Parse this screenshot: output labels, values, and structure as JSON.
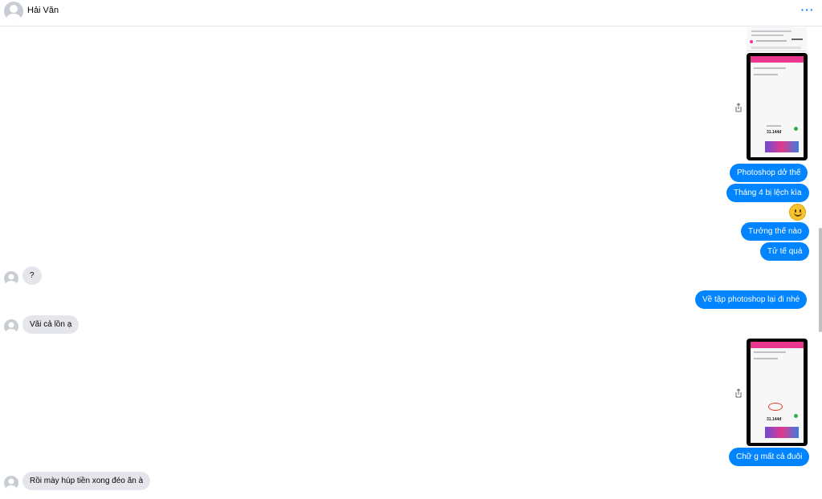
{
  "header": {
    "contact_name": "Hải Văn",
    "more_icon": "ellipsis-icon",
    "more_label": "···"
  },
  "messages": {
    "out_1": "Photoshop dở thế",
    "out_2": "Tháng 4 bị lệch kìa",
    "emoji": "slightly-smiling-face",
    "out_3": "Tưởng thế nào",
    "out_4": "Tử tế quá",
    "in_1": "?",
    "out_5": "Về tập photoshop lại đi nhé",
    "in_2": "Vãi cả lồn ạ",
    "out_6": "Chữ g mất cả đuôi",
    "in_3": "Rồi mày húp tiền xong đéo ăn à"
  },
  "screenshots": {
    "shot_1_amount": "31.144đ",
    "shot_2_amount": "31.144đ"
  },
  "colors": {
    "outgoing_bubble": "#0084ff",
    "incoming_bubble": "#e4e6eb",
    "accent": "#0084ff"
  }
}
